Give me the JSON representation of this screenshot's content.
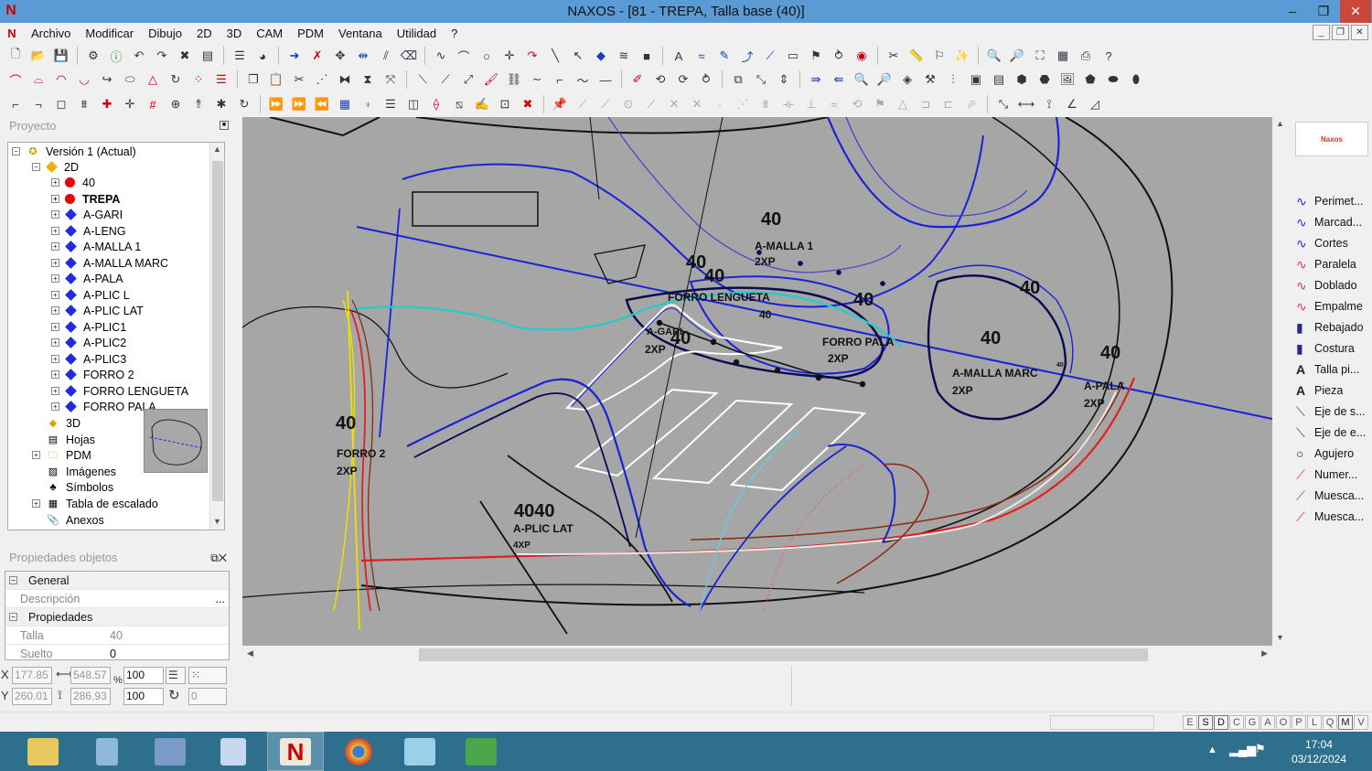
{
  "window": {
    "title": "NAXOS - [81 - TREPA, Talla base (40)]",
    "min": "–",
    "max": "❐",
    "close": "✕"
  },
  "menu": [
    "Archivo",
    "Modificar",
    "Dibujo",
    "2D",
    "3D",
    "CAM",
    "PDM",
    "Ventana",
    "Utilidad",
    "?"
  ],
  "project_panel": {
    "title": "Proyecto",
    "tree": [
      {
        "label": "Versión 1 (Actual)",
        "level": 0,
        "icon": "version-icon"
      },
      {
        "label": "2D",
        "level": 1,
        "icon": "diamond-2d-icon"
      },
      {
        "label": "40",
        "level": 2,
        "icon": "red-dot"
      },
      {
        "label": "TREPA",
        "level": 2,
        "icon": "red-dot",
        "bold": true
      },
      {
        "label": "A-GARI",
        "level": 2,
        "icon": "blue-diamond"
      },
      {
        "label": "A-LENG",
        "level": 2,
        "icon": "blue-diamond"
      },
      {
        "label": "A-MALLA 1",
        "level": 2,
        "icon": "blue-diamond"
      },
      {
        "label": "A-MALLA MARC",
        "level": 2,
        "icon": "blue-diamond"
      },
      {
        "label": "A-PALA",
        "level": 2,
        "icon": "blue-diamond"
      },
      {
        "label": "A-PLIC L",
        "level": 2,
        "icon": "blue-diamond"
      },
      {
        "label": "A-PLIC LAT",
        "level": 2,
        "icon": "blue-diamond"
      },
      {
        "label": "A-PLIC1",
        "level": 2,
        "icon": "blue-diamond"
      },
      {
        "label": "A-PLIC2",
        "level": 2,
        "icon": "blue-diamond"
      },
      {
        "label": "A-PLIC3",
        "level": 2,
        "icon": "blue-diamond"
      },
      {
        "label": "FORRO 2",
        "level": 2,
        "icon": "blue-diamond"
      },
      {
        "label": "FORRO LENGUETA",
        "level": 2,
        "icon": "blue-diamond"
      },
      {
        "label": "FORRO PALA",
        "level": 2,
        "icon": "blue-diamond"
      },
      {
        "label": "3D",
        "level": 1,
        "icon": "cube-3d-icon"
      },
      {
        "label": "Hojas",
        "level": 1,
        "icon": "sheets-icon"
      },
      {
        "label": "PDM",
        "level": 1,
        "icon": "folder-icon"
      },
      {
        "label": "Imágenes",
        "level": 1,
        "icon": "images-icon"
      },
      {
        "label": "Símbolos",
        "level": 1,
        "icon": "symbols-icon"
      },
      {
        "label": "Tabla de escalado",
        "level": 1,
        "icon": "table-icon"
      },
      {
        "label": "Anexos",
        "level": 1,
        "icon": "clip-icon"
      }
    ]
  },
  "properties_panel": {
    "title": "Propiedades objetos",
    "general": "General",
    "descripcion_label": "Descripción",
    "descripcion_btn": "...",
    "propiedades": "Propiedades",
    "talla_label": "Talla",
    "talla_value": "40",
    "suelto_label": "Suelto",
    "suelto_value": "0"
  },
  "canvas_labels": [
    {
      "text": "40"
    },
    {
      "text": "A-MALLA 1"
    },
    {
      "text": "2XP"
    },
    {
      "text": "40"
    },
    {
      "text": "40"
    },
    {
      "text": "FORRO LENGUETA"
    },
    {
      "text": "40"
    },
    {
      "text": "40"
    },
    {
      "text": "40"
    },
    {
      "text": "A-GARI"
    },
    {
      "text": "2XP"
    },
    {
      "text": "40"
    },
    {
      "text": "FORRO PALA"
    },
    {
      "text": "2XP"
    },
    {
      "text": "40"
    },
    {
      "text": "40"
    },
    {
      "text": "A-MALLA MARC"
    },
    {
      "text": "2XP"
    },
    {
      "text": "40"
    },
    {
      "text": "A-PALA"
    },
    {
      "text": "2XP"
    },
    {
      "text": "40"
    },
    {
      "text": "FORRO 2"
    },
    {
      "text": "2XP"
    },
    {
      "text": "4040"
    },
    {
      "text": "A-PLIC LAT"
    },
    {
      "text": "4XP"
    }
  ],
  "right_panel": {
    "logo": "Naxos",
    "tools": [
      "Perimet...",
      "Marcad...",
      "Cortes",
      "Paralela",
      "Doblado",
      "Empalme",
      "Rebajado",
      "Costura",
      "Talla pi...",
      "Pieza",
      "Eje de s...",
      "Eje de e...",
      "Agujero",
      "Numer...",
      "Muesca...",
      "Muesca..."
    ]
  },
  "coords": {
    "x_label": "X",
    "y_label": "Y",
    "x": "177.85",
    "y": "260.01",
    "w": "548.57",
    "h": "286.93",
    "pct_label": "%",
    "scale_x": "100",
    "scale_y": "100",
    "rotation": "0"
  },
  "snap_letters": [
    "E",
    "S",
    "D",
    "C",
    "G",
    "A",
    "O",
    "P",
    "L",
    "Q",
    "M",
    "V"
  ],
  "taskbar": {
    "time": "17:04",
    "date": "03/12/2024"
  }
}
